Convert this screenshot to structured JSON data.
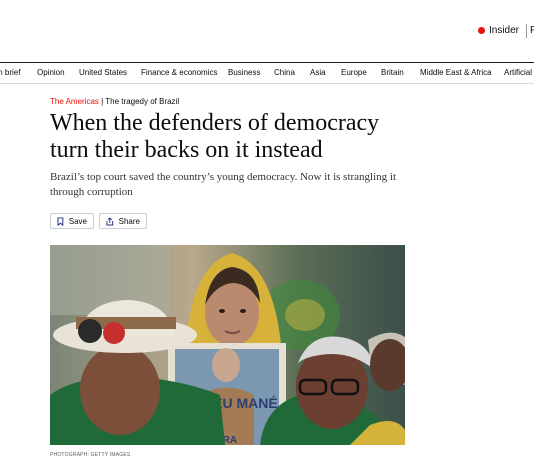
{
  "header": {
    "insider_label": "Insider",
    "truncated_link": "Fe"
  },
  "nav": {
    "items": [
      "m brief",
      "Opinion",
      "United States",
      "Finance & economics",
      "Business",
      "China",
      "Asia",
      "Europe",
      "Britain",
      "Middle East & Africa",
      "Artificial"
    ]
  },
  "article": {
    "section": "The Americas",
    "separator": "|",
    "flytitle": "The tragedy of Brazil",
    "headline": "When the defenders of democracy turn their backs on it instead",
    "subheadline": "Brazil’s top court saved the country’s young democracy. Now it is strangling it through corruption",
    "save_label": "Save",
    "share_label": "Share",
    "photo_sign_text": "PERDEU MANÉ",
    "photo_sign_bottom": "ORA",
    "photo_credit": "PHOTOGRAPH: GETTY IMAGES"
  },
  "colors": {
    "accent": "#e3120b",
    "text": "#0d0d0d"
  }
}
